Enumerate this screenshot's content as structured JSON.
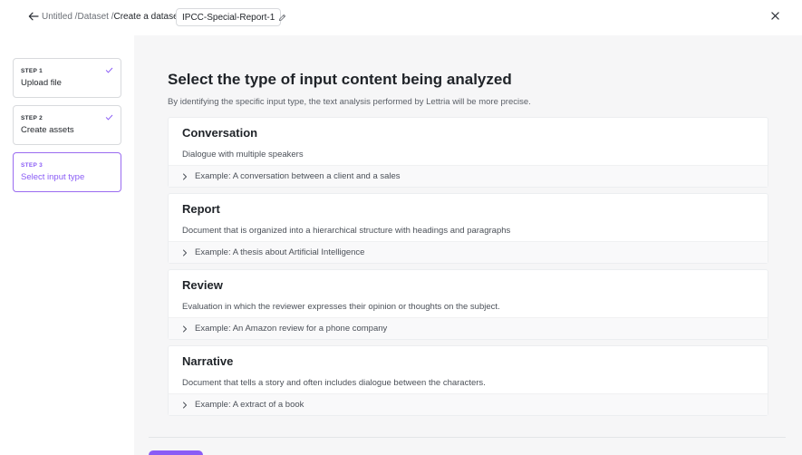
{
  "header": {
    "breadcrumb": [
      {
        "label": "Untitled /"
      },
      {
        "label": "Dataset /"
      },
      {
        "label": "Create a dataset"
      }
    ],
    "dataset_name": "IPCC-Special-Report-1",
    "icons": {
      "back": "arrow-left-icon",
      "edit": "pencil-icon",
      "close": "close-icon"
    }
  },
  "steps": [
    {
      "step": "STEP 1",
      "label": "Upload file",
      "completed": true,
      "active": false
    },
    {
      "step": "STEP 2",
      "label": "Create assets",
      "completed": true,
      "active": false
    },
    {
      "step": "STEP 3",
      "label": "Select input type",
      "completed": false,
      "active": true
    }
  ],
  "main": {
    "title": "Select the type of input content being analyzed",
    "subtitle": "By identifying the specific input type, the text analysis performed by Lettria will be more precise.",
    "options": [
      {
        "title": "Conversation",
        "description": "Dialogue with multiple speakers",
        "example": "Example: A conversation between a client and a sales"
      },
      {
        "title": "Report",
        "description": "Document that is organized into a hierarchical structure with headings and paragraphs",
        "example": "Example: A thesis about Artificial Intelligence"
      },
      {
        "title": "Review",
        "description": "Evaluation in which the reviewer expresses their opinion or thoughts on the subject.",
        "example": "Example: An Amazon review for a phone company"
      },
      {
        "title": "Narrative",
        "description": "Document that tells a story and often includes dialogue between the characters.",
        "example": "Example: A extract of a book"
      }
    ]
  },
  "colors": {
    "accent": "#8a5cf6",
    "background_main": "#f6f6f7",
    "border": "#d8dadd"
  }
}
